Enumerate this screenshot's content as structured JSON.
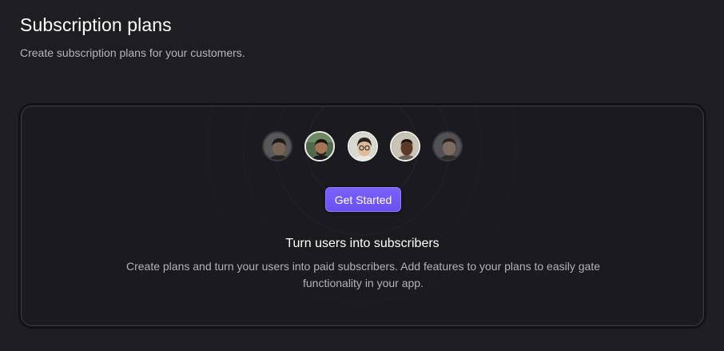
{
  "header": {
    "title": "Subscription plans",
    "subtitle": "Create subscription plans for your customers."
  },
  "empty_state": {
    "avatars": [
      {
        "name": "avatar-1",
        "style": "faded"
      },
      {
        "name": "avatar-2",
        "style": "bright"
      },
      {
        "name": "avatar-3",
        "style": "bright"
      },
      {
        "name": "avatar-4",
        "style": "bright"
      },
      {
        "name": "avatar-5",
        "style": "faded"
      }
    ],
    "cta_label": "Get Started",
    "heading": "Turn users into subscribers",
    "description": "Create plans and turn your users into paid subscribers. Add features to your plans to easily gate functionality in your app."
  },
  "colors": {
    "background": "#1e1d22",
    "card": "#1b1a1f",
    "accent": "#6f56f8",
    "text_primary": "#ffffff",
    "text_secondary": "#b3b2b8"
  }
}
